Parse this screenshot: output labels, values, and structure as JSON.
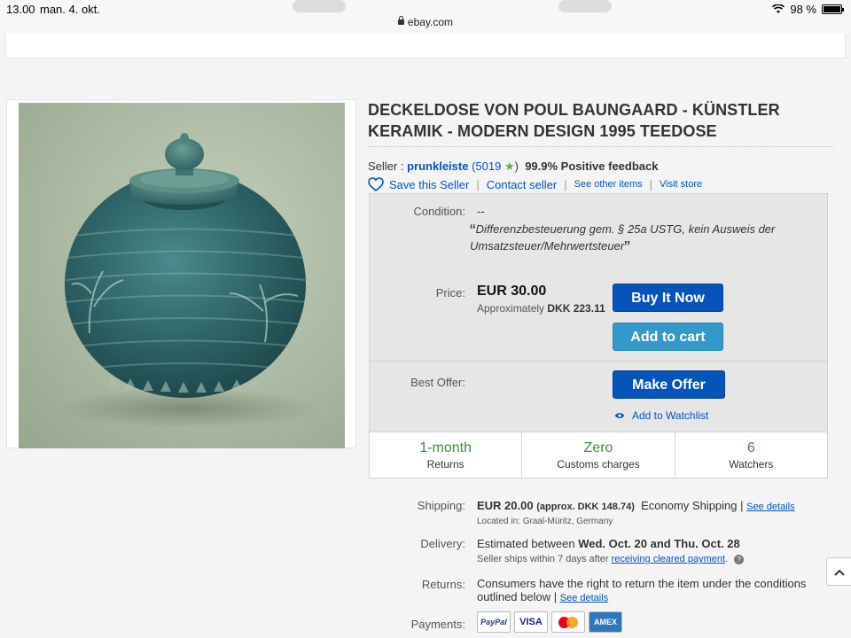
{
  "status_bar": {
    "time": "13.00",
    "date": "man. 4. okt.",
    "url": "ebay.com",
    "battery_text": "98 %",
    "battery_level": 0.98
  },
  "listing": {
    "title": "DECKELDOSE VON POUL BAUNGAARD - KÜNSTLER KERAMIK - MODERN DESIGN 1995 TEEDOSE",
    "seller": {
      "label": "Seller :",
      "name": "prunkleiste",
      "count_open": "(5019",
      "count_close": ")",
      "feedback": "99.9% Positive feedback"
    },
    "actions": {
      "save": "Save this Seller",
      "contact": "Contact seller",
      "other_items": "See other items",
      "visit_store": "Visit store",
      "sep": "|"
    },
    "condition": {
      "label": "Condition:",
      "value": "--",
      "note": "Differenzbesteuerung gem. § 25a USTG, kein Ausweis der Umsatzsteuer/Mehrwertsteuer"
    },
    "price": {
      "label": "Price:",
      "value": "EUR 30.00",
      "approx_prefix": "Approximately",
      "approx_value": "DKK 223.11"
    },
    "buttons": {
      "buy_now": "Buy It Now",
      "add_to_cart": "Add to cart",
      "make_offer": "Make Offer"
    },
    "best_offer": {
      "label": "Best Offer:",
      "watchlist": "Add to Watchlist"
    },
    "stats": [
      {
        "value": "1-month",
        "label": "Returns"
      },
      {
        "value": "Zero",
        "label": "Customs charges"
      },
      {
        "value": "6",
        "label": "Watchers"
      }
    ],
    "shipping": {
      "label": "Shipping:",
      "value": "EUR 20.00",
      "approx": "(approx. DKK 148.74)",
      "method": "Economy Shipping",
      "sep": "|",
      "details": "See details",
      "location": "Located in:  Graal-Müritz, Germany"
    },
    "delivery": {
      "label": "Delivery:",
      "prefix": "Estimated between",
      "dates": "Wed. Oct. 20 and Thu. Oct. 28",
      "sub_prefix": "Seller ships within 7 days after",
      "sub_link": "receiving cleared payment",
      "sub_suffix": ".",
      "help": "?"
    },
    "returns": {
      "label": "Returns:",
      "text1": "Consumers have the right to return the item under the conditions",
      "text2": "outlined below |",
      "details": "See details"
    },
    "payments": {
      "label": "Payments:",
      "methods": [
        "PayPal",
        "VISA",
        "Mastercard",
        "AMEX"
      ],
      "paypal": "PayPal",
      "visa": "VISA",
      "amex": "AMEX"
    }
  },
  "colors": {
    "ebay_blue": "#0654ba",
    "cart_blue": "#3498ca",
    "stat_green": "#3a8f3a",
    "star_green": "#5bae3f"
  },
  "icons": [
    "lock-icon",
    "wifi-icon",
    "battery-icon",
    "star-icon",
    "heart-icon",
    "eye-icon",
    "chevron-up-icon"
  ]
}
